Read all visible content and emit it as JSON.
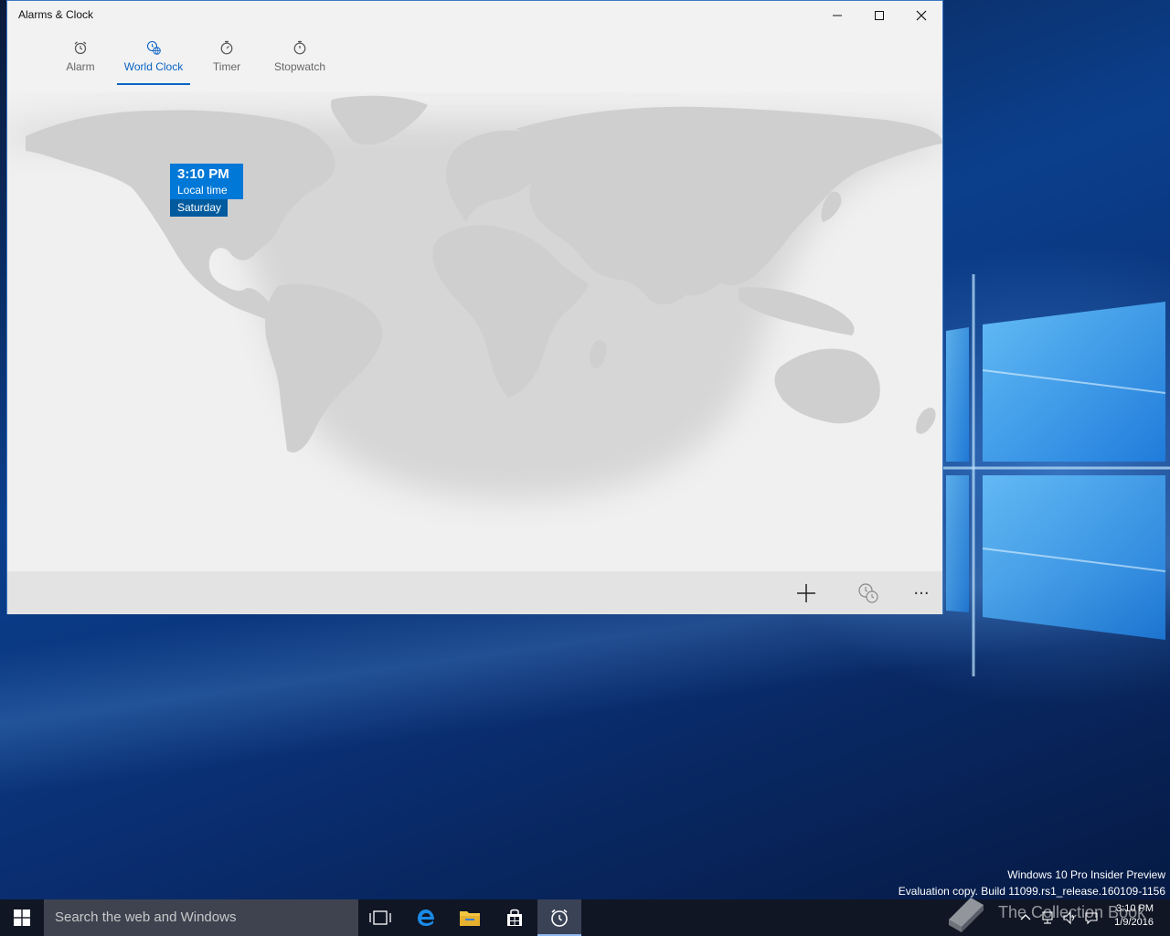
{
  "window": {
    "title": "Alarms & Clock",
    "accent_color": "#0078d7"
  },
  "tabs": [
    {
      "label": "Alarm",
      "icon": "alarm-clock-icon",
      "active": false
    },
    {
      "label": "World Clock",
      "icon": "world-clock-icon",
      "active": true
    },
    {
      "label": "Timer",
      "icon": "timer-icon",
      "active": false
    },
    {
      "label": "Stopwatch",
      "icon": "stopwatch-icon",
      "active": false
    }
  ],
  "local_clock": {
    "time": "3:10 PM",
    "label": "Local time",
    "day": "Saturday"
  },
  "app_bar": {
    "add_icon": "plus-icon",
    "compare_icon": "compare-clocks-icon",
    "more_label": "···"
  },
  "desktop": {
    "watermark_line1": "Windows 10 Pro Insider Preview",
    "watermark_line2": "Evaluation copy. Build 11099.rs1_release.160109-1156"
  },
  "taskbar": {
    "search_placeholder": "Search the web and Windows",
    "clock_time": "3:10 PM",
    "clock_date": "1/9/2016"
  },
  "overlay_watermark": {
    "text": "The Collection Book"
  }
}
